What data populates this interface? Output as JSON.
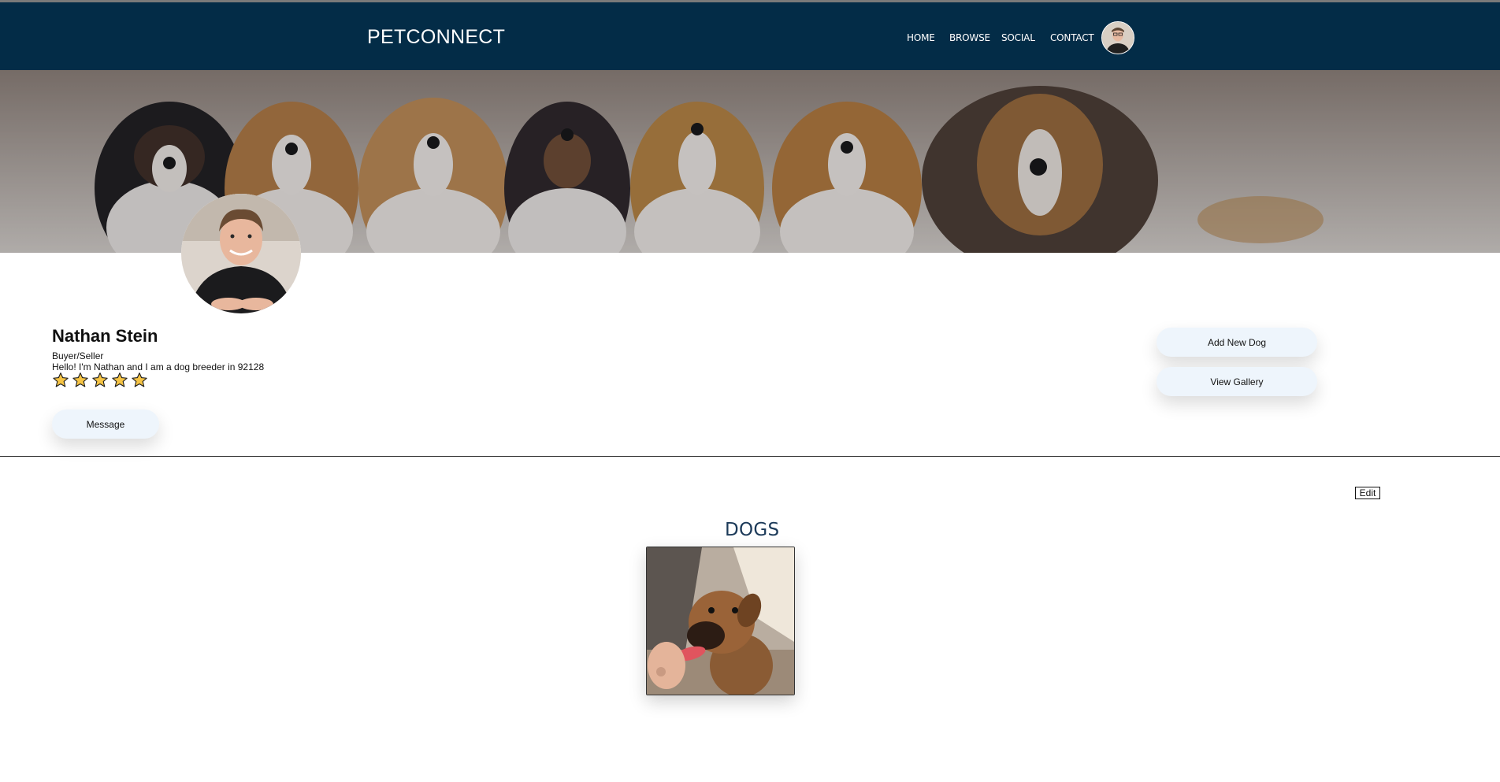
{
  "nav": {
    "brand": "PETCONNECT",
    "links": [
      "HOME",
      "BROWSE",
      "SOCIAL",
      "CONTACT"
    ]
  },
  "profile": {
    "name": "Nathan Stein",
    "role": "Buyer/Seller",
    "bio": "Hello! I'm Nathan and I am a dog breeder in 92128",
    "rating": 5,
    "rating_max": 5,
    "message_label": "Message"
  },
  "actions": {
    "add_dog_label": "Add New Dog",
    "gallery_label": "View Gallery"
  },
  "dogs": {
    "edit_label": "Edit",
    "title": "DOGS"
  },
  "colors": {
    "nav_bg": "#032c47",
    "button_bg": "#eef5fc",
    "star": "#f6c445",
    "title": "#1c3a59"
  }
}
